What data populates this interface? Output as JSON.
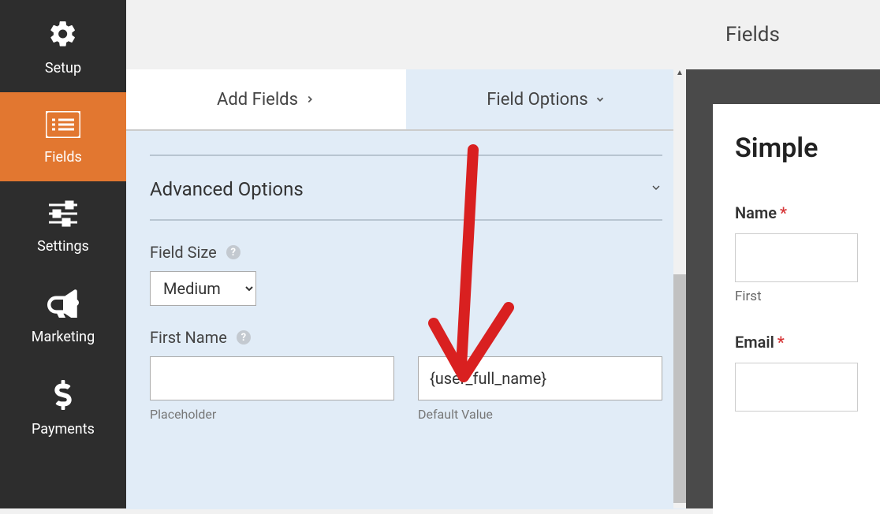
{
  "sidebar": {
    "items": [
      {
        "label": "Setup"
      },
      {
        "label": "Fields"
      },
      {
        "label": "Settings"
      },
      {
        "label": "Marketing"
      },
      {
        "label": "Payments"
      }
    ]
  },
  "tabs": {
    "add": "Add Fields",
    "options": "Field Options"
  },
  "section": {
    "title": "Advanced Options"
  },
  "field_size": {
    "label": "Field Size",
    "value": "Medium"
  },
  "first_name": {
    "label": "First Name",
    "placeholder_value": "",
    "default_value": "{user_full_name}",
    "placeholder_sublabel": "Placeholder",
    "default_sublabel": "Default Value"
  },
  "right": {
    "header": "Fields",
    "form_title": "Simple",
    "name_label": "Name",
    "name_sublabel": "First",
    "email_label": "Email"
  }
}
